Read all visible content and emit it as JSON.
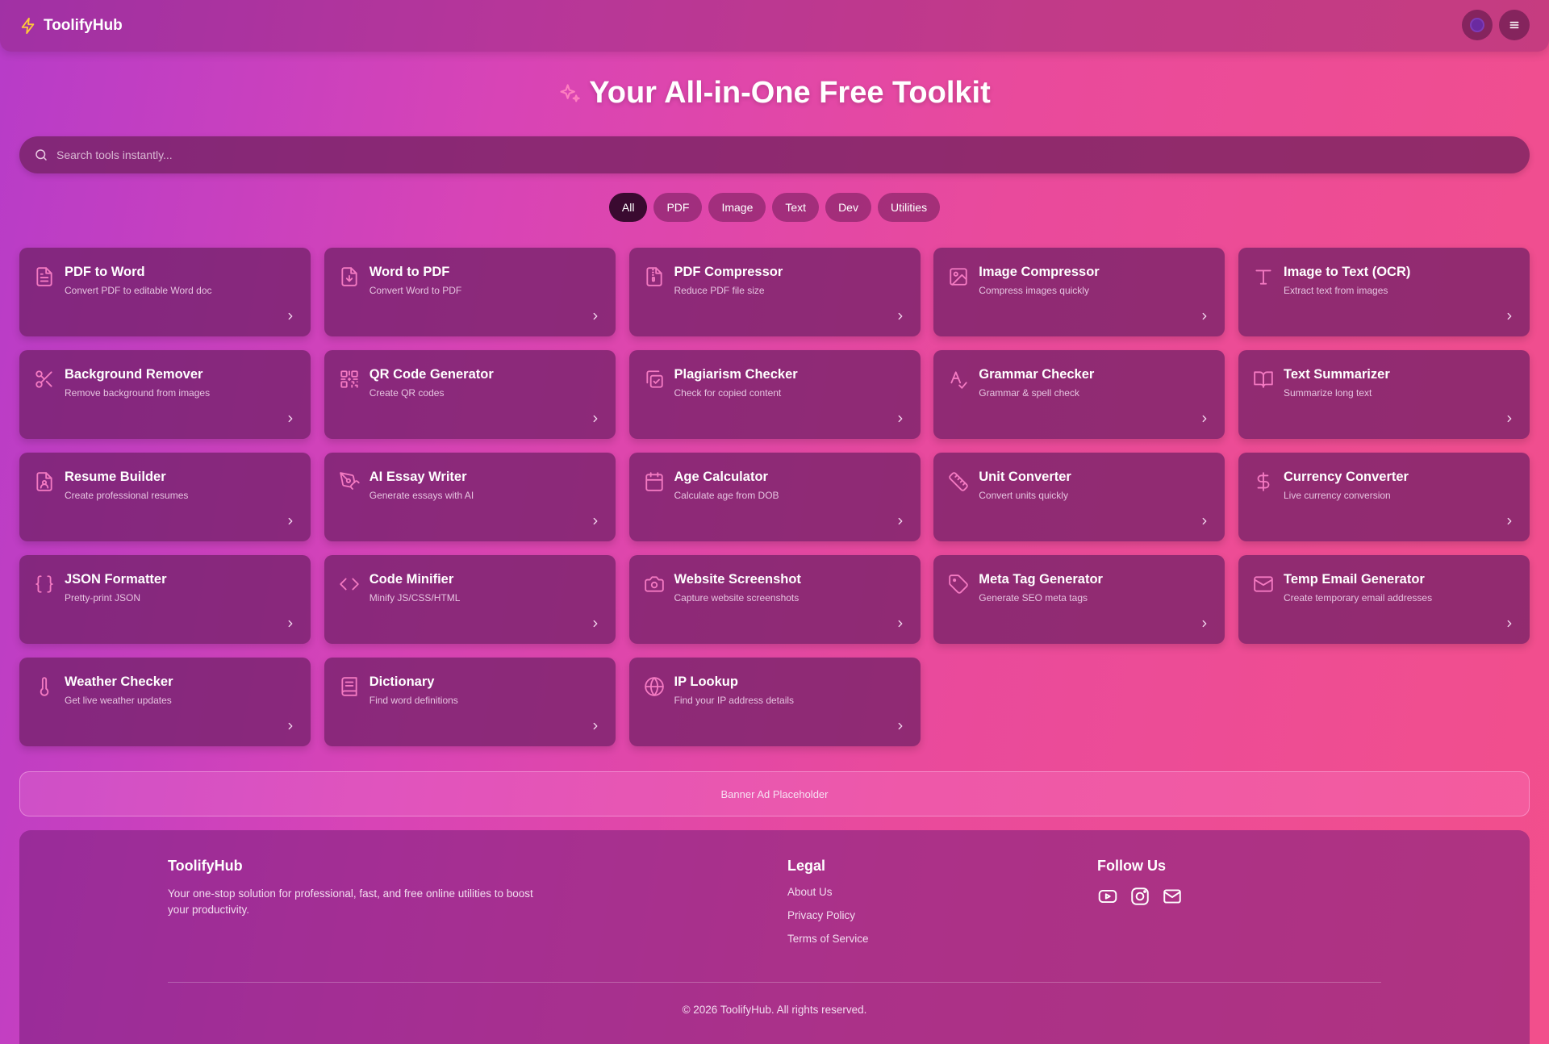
{
  "header": {
    "brand": "ToolifyHub",
    "brand_icon": "lightning-icon",
    "actions": [
      "theme-toggle-icon",
      "menu-icon"
    ]
  },
  "hero": {
    "title": "Your All-in-One Free Toolkit",
    "icon": "sparkles-icon"
  },
  "search": {
    "placeholder": "Search tools instantly..."
  },
  "filters": [
    "All",
    "PDF",
    "Image",
    "Text",
    "Dev",
    "Utilities"
  ],
  "active_filter": "All",
  "tools": [
    {
      "title": "PDF to Word",
      "desc": "Convert PDF to editable Word doc",
      "icon": "file-text-icon"
    },
    {
      "title": "Word to PDF",
      "desc": "Convert Word to PDF",
      "icon": "file-download-icon"
    },
    {
      "title": "PDF Compressor",
      "desc": "Reduce PDF file size",
      "icon": "file-archive-icon"
    },
    {
      "title": "Image Compressor",
      "desc": "Compress images quickly",
      "icon": "image-icon"
    },
    {
      "title": "Image to Text (OCR)",
      "desc": "Extract text from images",
      "icon": "type-icon"
    },
    {
      "title": "Background Remover",
      "desc": "Remove background from images",
      "icon": "scissors-icon"
    },
    {
      "title": "QR Code Generator",
      "desc": "Create QR codes",
      "icon": "qr-code-icon"
    },
    {
      "title": "Plagiarism Checker",
      "desc": "Check for copied content",
      "icon": "copy-check-icon"
    },
    {
      "title": "Grammar Checker",
      "desc": "Grammar & spell check",
      "icon": "spell-check-icon"
    },
    {
      "title": "Text Summarizer",
      "desc": "Summarize long text",
      "icon": "book-open-icon"
    },
    {
      "title": "Resume Builder",
      "desc": "Create professional resumes",
      "icon": "file-user-icon"
    },
    {
      "title": "AI Essay Writer",
      "desc": "Generate essays with AI",
      "icon": "pen-tool-icon"
    },
    {
      "title": "Age Calculator",
      "desc": "Calculate age from DOB",
      "icon": "calendar-icon"
    },
    {
      "title": "Unit Converter",
      "desc": "Convert units quickly",
      "icon": "ruler-icon"
    },
    {
      "title": "Currency Converter",
      "desc": "Live currency conversion",
      "icon": "dollar-icon"
    },
    {
      "title": "JSON Formatter",
      "desc": "Pretty-print JSON",
      "icon": "braces-icon"
    },
    {
      "title": "Code Minifier",
      "desc": "Minify JS/CSS/HTML",
      "icon": "code-icon"
    },
    {
      "title": "Website Screenshot",
      "desc": "Capture website screenshots",
      "icon": "camera-icon"
    },
    {
      "title": "Meta Tag Generator",
      "desc": "Generate SEO meta tags",
      "icon": "tag-icon"
    },
    {
      "title": "Temp Email Generator",
      "desc": "Create temporary email addresses",
      "icon": "mail-icon"
    },
    {
      "title": "Weather Checker",
      "desc": "Get live weather updates",
      "icon": "thermometer-icon"
    },
    {
      "title": "Dictionary",
      "desc": "Find word definitions",
      "icon": "book-icon"
    },
    {
      "title": "IP Lookup",
      "desc": "Find your IP address details",
      "icon": "globe-icon"
    }
  ],
  "banner": {
    "text": "Banner Ad Placeholder"
  },
  "footer": {
    "brand": "ToolifyHub",
    "tagline": "Your one-stop solution for professional, fast, and free online utilities to boost your productivity.",
    "legal_heading": "Legal",
    "legal_links": [
      "About Us",
      "Privacy Policy",
      "Terms of Service"
    ],
    "follow_heading": "Follow Us",
    "social": [
      "youtube-icon",
      "instagram-icon",
      "mail-icon"
    ],
    "copyright": "© 2026 ToolifyHub. All rights reserved."
  },
  "colors": {
    "accent_icon": "#f47ac2",
    "brand_icon": "#ffc83a",
    "active_chip": "#3a0a30"
  }
}
